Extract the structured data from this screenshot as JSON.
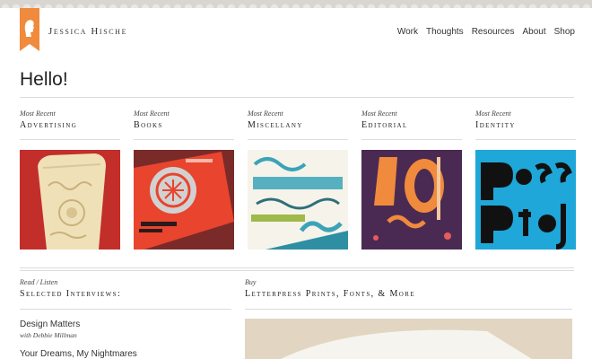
{
  "site": {
    "title": "Jessica Hische"
  },
  "nav": {
    "items": [
      "Work",
      "Thoughts",
      "Resources",
      "About",
      "Shop"
    ]
  },
  "main": {
    "greeting": "Hello!"
  },
  "recent": {
    "kicker": "Most Recent",
    "categories": [
      {
        "label": "Advertising",
        "thumb_colors": [
          "#c8322b",
          "#efe0b8"
        ]
      },
      {
        "label": "Books",
        "thumb_colors": [
          "#e8442e",
          "#cfcfcf"
        ]
      },
      {
        "label": "Miscellany",
        "thumb_colors": [
          "#3ba3b8",
          "#ffffff"
        ]
      },
      {
        "label": "Editorial",
        "thumb_colors": [
          "#4a2a52",
          "#f08a3c"
        ]
      },
      {
        "label": "Identity",
        "thumb_colors": [
          "#1ea7d8",
          "#111111"
        ]
      }
    ]
  },
  "interviews": {
    "kicker": "Read / Listen",
    "title": "Selected Interviews:",
    "items": [
      {
        "title": "Design Matters",
        "sub": "with Debbie Millman"
      },
      {
        "title": "Your Dreams, My Nightmares",
        "sub": ""
      }
    ]
  },
  "shop": {
    "kicker": "Buy",
    "title": "Letterpress Prints, Fonts, & More"
  },
  "colors": {
    "accent": "#f08a3c",
    "rule": "#dcdcdc",
    "text": "#222222"
  }
}
